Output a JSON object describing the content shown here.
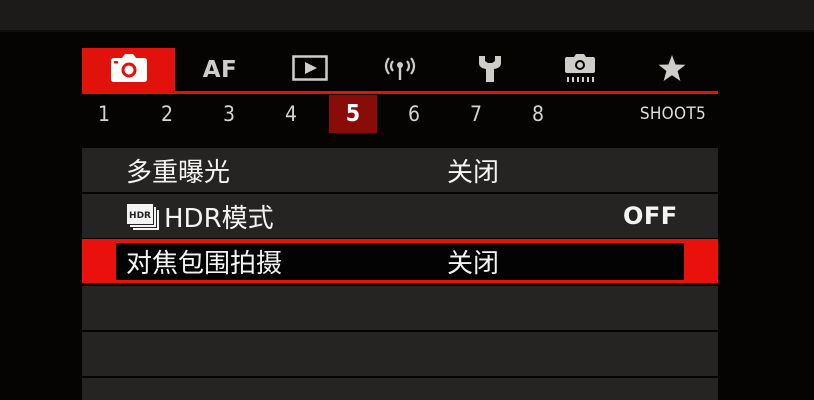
{
  "colors": {
    "accent": "#e0120b",
    "page_active": "#8a0c08",
    "row_bg": "#262422",
    "background": "#050403"
  },
  "tabs": [
    {
      "name": "camera-shooting",
      "icon": "camera-icon",
      "active": true
    },
    {
      "name": "autofocus",
      "label": "AF",
      "active": false
    },
    {
      "name": "playback",
      "icon": "play-icon",
      "active": false
    },
    {
      "name": "wireless",
      "icon": "wireless-icon",
      "active": false
    },
    {
      "name": "setup",
      "icon": "wrench-icon",
      "active": false
    },
    {
      "name": "custom-functions",
      "icon": "custom-camera-icon",
      "active": false
    },
    {
      "name": "my-menu",
      "icon": "star-icon",
      "active": false
    }
  ],
  "pages": {
    "numbers": [
      "1",
      "2",
      "3",
      "4",
      "5",
      "6",
      "7",
      "8"
    ],
    "active_index": 4,
    "label": "SHOOT5"
  },
  "menu": {
    "rows": [
      {
        "label": "多重曝光",
        "value": "关闭",
        "selected": false
      },
      {
        "label": "HDR模式",
        "icon": "hdr-icon",
        "value": "OFF",
        "selected": false
      },
      {
        "label": "对焦包围拍摄",
        "value": "关闭",
        "selected": true
      }
    ]
  }
}
